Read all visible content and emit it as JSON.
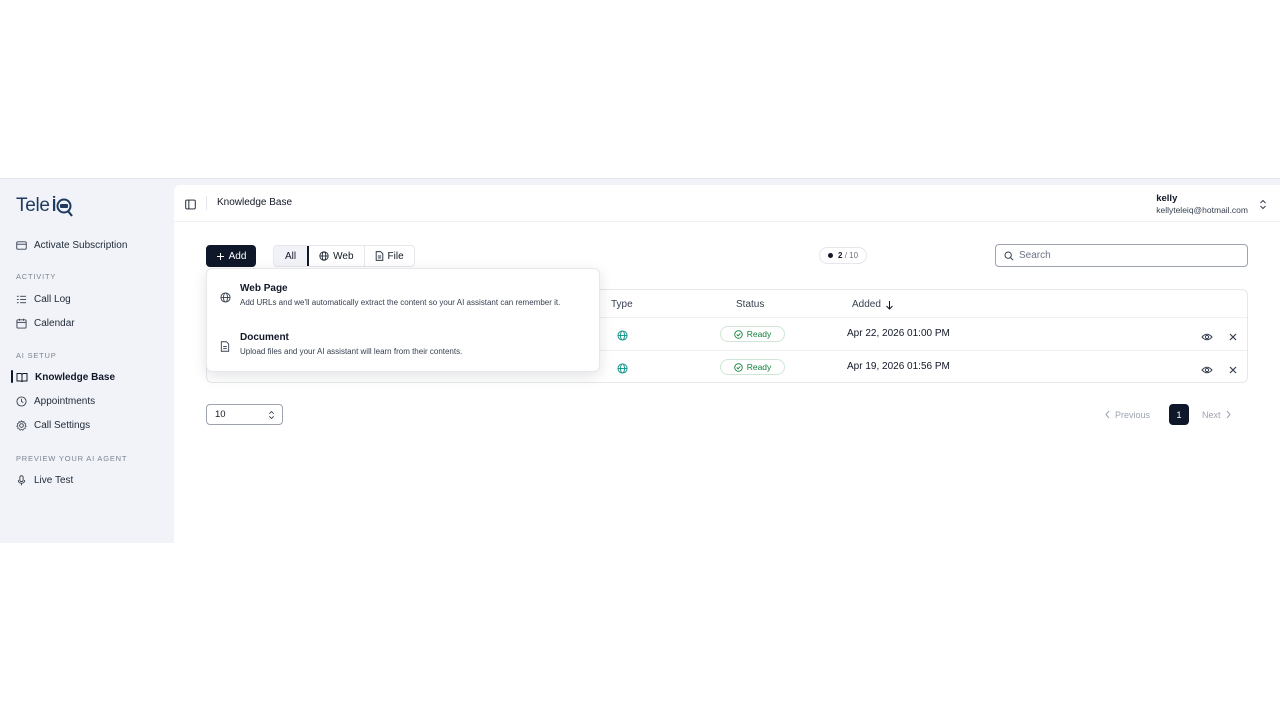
{
  "app": {
    "logo_text": "Tele",
    "logo_suffix": "Q"
  },
  "sidebar": {
    "activate": "Activate Subscription",
    "sections": {
      "activity": "ACTIVITY",
      "ai_setup": "AI SETUP",
      "preview": "PREVIEW YOUR AI AGENT"
    },
    "items": {
      "call_log": "Call Log",
      "calendar": "Calendar",
      "knowledge_base": "Knowledge Base",
      "appointments": "Appointments",
      "call_settings": "Call Settings",
      "live_test": "Live Test"
    }
  },
  "header": {
    "breadcrumb": "Knowledge Base",
    "user_name": "kelly",
    "user_email": "kellyteleiq@hotmail.com"
  },
  "toolbar": {
    "add_label": "Add",
    "filters": [
      "All",
      "Web",
      "File"
    ],
    "counter_current": "2",
    "counter_total": "/ 10",
    "search_placeholder": "Search"
  },
  "table": {
    "columns": {
      "type": "Type",
      "status": "Status",
      "added": "Added"
    },
    "rows": [
      {
        "type": "web",
        "status": "Ready",
        "added": "Apr 22, 2026 01:00 PM"
      },
      {
        "type": "web",
        "status": "Ready",
        "added": "Apr 19, 2026 01:56 PM"
      }
    ]
  },
  "pagination": {
    "page_size": "10",
    "previous": "Previous",
    "current_page": "1",
    "next": "Next"
  },
  "add_menu": {
    "web_page": {
      "title": "Web Page",
      "description": "Add URLs and we'll automatically extract the content so your AI assistant can remember it."
    },
    "document": {
      "title": "Document",
      "description": "Upload files and your AI assistant will learn from their contents."
    }
  },
  "colors": {
    "primary": "#0f172a",
    "sidebar_bg": "#f1f3f8",
    "ready_green": "#15803d",
    "globe_teal": "#0d9488"
  }
}
